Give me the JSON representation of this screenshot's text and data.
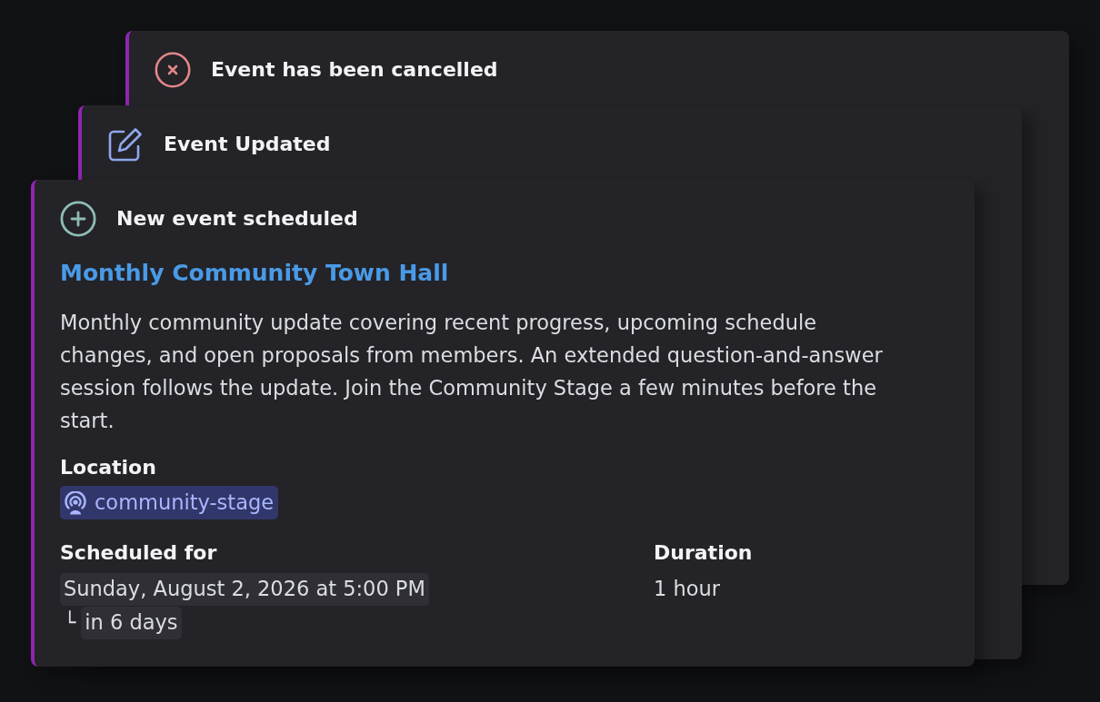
{
  "cards": [
    {
      "kind": "cancelled",
      "title": "Event has been cancelled"
    },
    {
      "kind": "updated",
      "title": "Event Updated"
    },
    {
      "kind": "created",
      "title": "New event scheduled",
      "event_name": "Monthly Community Town Hall",
      "description": "Monthly community update covering recent progress, upcoming schedule changes, and open proposals from members. An extended question-and-answer session follows the update. Join the Community Stage a few minutes before the start.",
      "location": {
        "label": "Location",
        "channel": "community-stage"
      },
      "schedule": {
        "label": "Scheduled for",
        "date": "Sunday, August 2, 2026 at 5:00 PM",
        "branch": "└",
        "relative": "in 6 days"
      },
      "duration": {
        "label": "Duration",
        "value": "1 hour"
      }
    }
  ]
}
